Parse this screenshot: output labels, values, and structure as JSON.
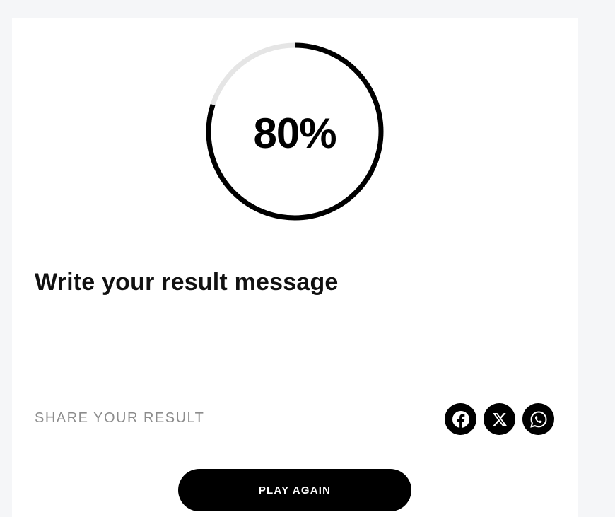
{
  "result": {
    "score_text": "80%",
    "score_fraction": 0.8,
    "message": "Write your result message"
  },
  "share": {
    "label": "SHARE YOUR RESULT",
    "icons": [
      "facebook-icon",
      "x-icon",
      "whatsapp-icon"
    ]
  },
  "actions": {
    "play_again_label": "PLAY AGAIN"
  },
  "colors": {
    "ring_progress": "#000000",
    "ring_track": "#e5e5e5",
    "page_background": "#f5f6f8",
    "card_background": "#ffffff",
    "button_background": "#000000",
    "share_label": "#8c8c8c"
  }
}
